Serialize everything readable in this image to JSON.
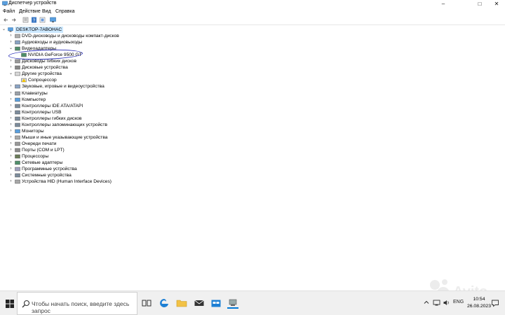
{
  "window": {
    "title": "Диспетчер устройств",
    "minimize": "–",
    "maximize": "□",
    "close": "✕"
  },
  "menu": [
    "Файл",
    "Действие",
    "Вид",
    "Справка"
  ],
  "toolbar": [
    "back-icon",
    "forward-icon",
    "properties-icon",
    "help-icon",
    "monitor-icon"
  ],
  "tree": {
    "root": "DESKTOP-7ABOHAC",
    "items": [
      {
        "label": "DVD-дисководы и дисководы компакт-дисков",
        "expanded": false,
        "icon": "dvd-drive-icon"
      },
      {
        "label": "Аудиовходы и аудиовыходы",
        "expanded": false,
        "icon": "speaker-icon"
      },
      {
        "label": "Видеоадаптеры",
        "expanded": true,
        "icon": "display-adapter-icon",
        "children": [
          {
            "label": "NVIDIA GeForce 9500 GT",
            "icon": "display-adapter-icon"
          }
        ]
      },
      {
        "label": "Дисководы гибких дисков",
        "expanded": false,
        "icon": "floppy-drive-icon"
      },
      {
        "label": "Дисковые устройства",
        "expanded": false,
        "icon": "disk-drive-icon"
      },
      {
        "label": "Другие устройства",
        "expanded": true,
        "icon": "unknown-device-icon",
        "children": [
          {
            "label": "Сопроцессор",
            "icon": "warning-device-icon"
          }
        ]
      },
      {
        "label": "Звуковые, игровые и видеоустройства",
        "expanded": false,
        "icon": "speaker-icon"
      },
      {
        "label": "Клавиатуры",
        "expanded": false,
        "icon": "keyboard-icon"
      },
      {
        "label": "Компьютер",
        "expanded": false,
        "icon": "computer-icon"
      },
      {
        "label": "Контроллеры IDE ATA/ATAPI",
        "expanded": false,
        "icon": "controller-icon"
      },
      {
        "label": "Контроллеры USB",
        "expanded": false,
        "icon": "usb-icon"
      },
      {
        "label": "Контроллеры гибких дисков",
        "expanded": false,
        "icon": "controller-icon"
      },
      {
        "label": "Контроллеры запоминающих устройств",
        "expanded": false,
        "icon": "storage-controller-icon"
      },
      {
        "label": "Мониторы",
        "expanded": false,
        "icon": "monitor-icon"
      },
      {
        "label": "Мыши и иные указывающие устройства",
        "expanded": false,
        "icon": "mouse-icon"
      },
      {
        "label": "Очереди печати",
        "expanded": false,
        "icon": "printer-icon"
      },
      {
        "label": "Порты (COM и LPT)",
        "expanded": false,
        "icon": "port-icon"
      },
      {
        "label": "Процессоры",
        "expanded": false,
        "icon": "processor-icon"
      },
      {
        "label": "Сетевые адаптеры",
        "expanded": false,
        "icon": "network-adapter-icon"
      },
      {
        "label": "Программные устройства",
        "expanded": false,
        "icon": "software-device-icon"
      },
      {
        "label": "Системные устройства",
        "expanded": false,
        "icon": "system-device-icon"
      },
      {
        "label": "Устройства HID (Human Interface Devices)",
        "expanded": false,
        "icon": "hid-icon"
      }
    ]
  },
  "taskbar": {
    "search_placeholder": "Чтобы начать поиск, введите здесь запрос",
    "apps": [
      "task-view-icon",
      "edge-icon",
      "file-explorer-icon",
      "mail-icon",
      "store-icon",
      "device-manager-icon"
    ],
    "lang": "ENG",
    "time": "10:54",
    "date": "26.08.2023"
  },
  "colors": {
    "selection": "#cce8ff",
    "annotation_circle": "#2b2fb8",
    "taskbar": "#f0f0f0",
    "accent": "#0078d7"
  }
}
